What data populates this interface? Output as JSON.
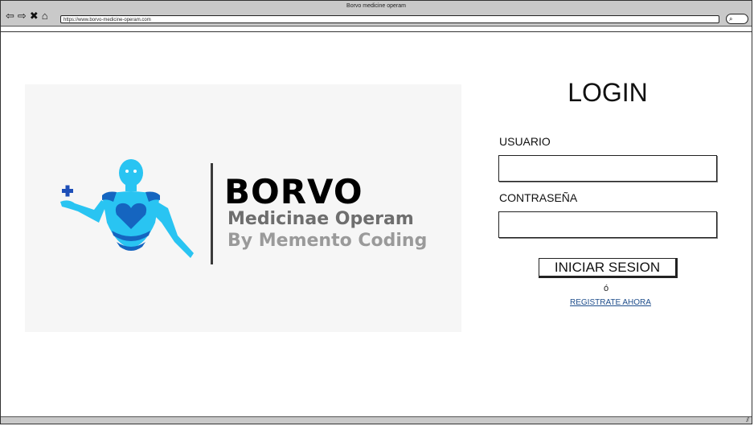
{
  "browser": {
    "window_title": "Borvo medicine operam",
    "url": "https://www.borvo-medicine-operam.com",
    "icons": [
      "back-arrow-icon",
      "forward-arrow-icon",
      "close-icon",
      "home-icon",
      "search-icon"
    ]
  },
  "logo": {
    "name": "BORVO",
    "subtitle": "Medicinae Operam",
    "byline": "By Memento Coding",
    "colors": {
      "light_blue": "#29c4f2",
      "dark_blue": "#1565c0",
      "accent_plus": "#1e4fb8"
    }
  },
  "login": {
    "title": "LOGIN",
    "username_label": "USUARIO",
    "password_label": "CONTRASEÑA",
    "username_value": "",
    "password_value": "",
    "submit_label": "INICIAR SESION",
    "or_text": "ó",
    "register_link": "REGISTRATE AHORA"
  }
}
